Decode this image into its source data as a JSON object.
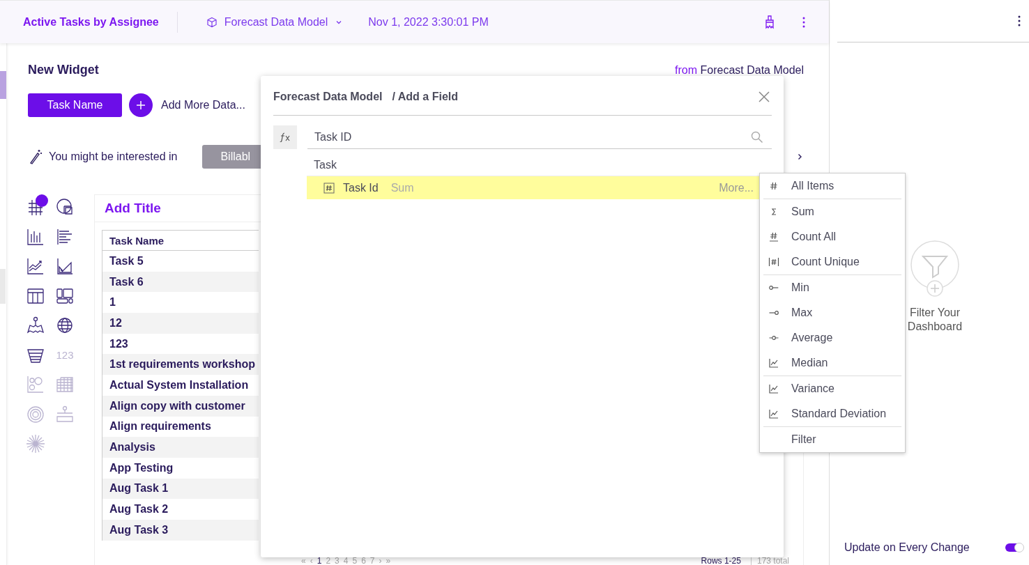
{
  "header": {
    "title": "Active Tasks by Assignee",
    "model": "Forecast Data Model",
    "timestamp": "Nov 1, 2022 3:30:01 PM"
  },
  "widget": {
    "title": "New Widget",
    "source_prefix": "from",
    "source": "Forecast Data Model",
    "fields": [
      "Task Name"
    ],
    "add_data": "Add More Data...",
    "suggestion_label": "You might be interested in",
    "suggestions": [
      "Billabl"
    ]
  },
  "chart_types": [
    {
      "kind": "pivot",
      "selected": true,
      "disabled": false
    },
    {
      "kind": "pie",
      "selected": false,
      "disabled": false
    },
    {
      "kind": "column",
      "selected": false,
      "disabled": false
    },
    {
      "kind": "bar",
      "selected": false,
      "disabled": false
    },
    {
      "kind": "line",
      "selected": false,
      "disabled": false
    },
    {
      "kind": "area",
      "selected": false,
      "disabled": false
    },
    {
      "kind": "table",
      "selected": false,
      "disabled": false
    },
    {
      "kind": "blocks",
      "selected": false,
      "disabled": false
    },
    {
      "kind": "map",
      "selected": false,
      "disabled": false
    },
    {
      "kind": "globe",
      "selected": false,
      "disabled": false
    },
    {
      "kind": "funnel",
      "selected": false,
      "disabled": false
    },
    {
      "kind": "number",
      "text": "123",
      "selected": false,
      "disabled": true
    },
    {
      "kind": "bubble",
      "selected": false,
      "disabled": true
    },
    {
      "kind": "heatmap",
      "selected": false,
      "disabled": true
    },
    {
      "kind": "radial",
      "selected": false,
      "disabled": true
    },
    {
      "kind": "tree",
      "selected": false,
      "disabled": true
    },
    {
      "kind": "sunburst",
      "selected": false,
      "disabled": true
    }
  ],
  "card": {
    "title": "Add Title",
    "column": "Task Name",
    "rows": [
      "Task 5",
      "Task 6",
      "1",
      "12",
      "123",
      "1st requirements workshop",
      "Actual System Installation",
      "Align copy with customer",
      "Align requirements",
      "Analysis",
      "App Testing",
      "Aug Task 1",
      "Aug Task 2",
      "Aug Task 3"
    ]
  },
  "pagination": {
    "first": "«",
    "prev": "‹",
    "pages": [
      {
        "label": "1",
        "selected": true
      },
      {
        "label": "2",
        "selected": false
      },
      {
        "label": "3",
        "selected": false
      },
      {
        "label": "4",
        "selected": false
      },
      {
        "label": "5",
        "selected": false
      },
      {
        "label": "6",
        "selected": false
      },
      {
        "label": "7",
        "selected": false
      }
    ],
    "next": "›",
    "last": "»",
    "rows": "Rows 1-25",
    "total": "173 total"
  },
  "dialog": {
    "breadcrumb": "Forecast Data Model",
    "step": "/ Add a Field",
    "search_value": "Task ID",
    "group": "Task",
    "fields": [
      {
        "name": "Task Id",
        "aggregation": "Sum",
        "more": "More...",
        "highlighted": true
      }
    ]
  },
  "menu": {
    "sections": [
      [
        {
          "kind": "hash",
          "label": "All Items"
        }
      ],
      [
        {
          "kind": "sigma",
          "label": "Sum"
        },
        {
          "kind": "hash-under",
          "label": "Count All"
        },
        {
          "kind": "hash-bars",
          "label": "Count Unique"
        }
      ],
      [
        {
          "kind": "min",
          "label": "Min"
        },
        {
          "kind": "max",
          "label": "Max"
        },
        {
          "kind": "avg",
          "label": "Average"
        },
        {
          "kind": "chart",
          "label": "Median"
        }
      ],
      [
        {
          "kind": "chart",
          "label": "Variance"
        },
        {
          "kind": "chart",
          "label": "Standard Deviation"
        }
      ],
      [
        {
          "kind": "plain",
          "label": "Filter"
        }
      ]
    ]
  },
  "right_panel": {
    "filter_text": "Filter Your Dashboard",
    "auto_update": {
      "label": "Update on Every Change",
      "on": true
    }
  }
}
